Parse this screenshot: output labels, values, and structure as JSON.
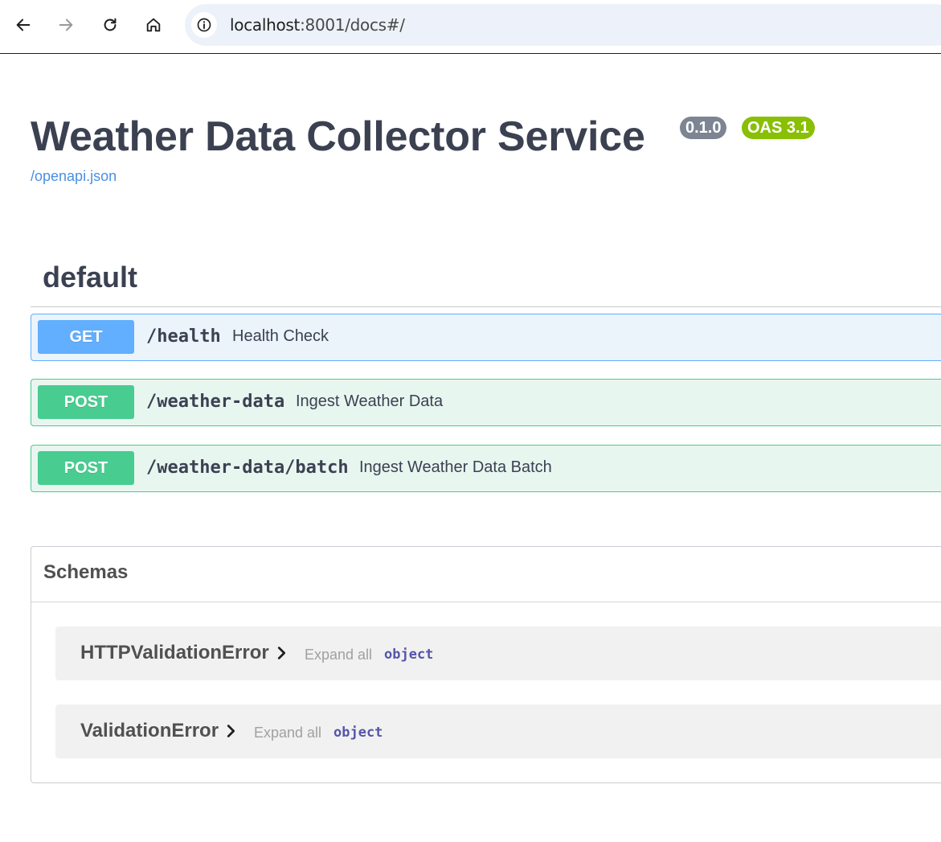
{
  "browser": {
    "url_host": "localhost",
    "url_rest": ":8001/docs#/",
    "icons": [
      "back-arrow-icon",
      "forward-arrow-icon",
      "reload-icon",
      "home-icon",
      "info-icon"
    ]
  },
  "page": {
    "title": "Weather Data Collector Service",
    "version_badge": "0.1.0",
    "oas_badge": "OAS 3.1",
    "spec_link": "/openapi.json",
    "colors": {
      "get": "#61affe",
      "post": "#49cc90",
      "version": "#7d8492",
      "oas": "#89bf04",
      "link": "#4990e2"
    }
  },
  "tag": {
    "name": "default"
  },
  "operations": [
    {
      "method": "GET",
      "path": "/health",
      "summary": "Health Check"
    },
    {
      "method": "POST",
      "path": "/weather-data",
      "summary": "Ingest Weather Data"
    },
    {
      "method": "POST",
      "path": "/weather-data/batch",
      "summary": "Ingest Weather Data Batch"
    }
  ],
  "schemas": {
    "title": "Schemas",
    "items": [
      {
        "name": "HTTPValidationError",
        "expand_label": "Expand all",
        "type": "object"
      },
      {
        "name": "ValidationError",
        "expand_label": "Expand all",
        "type": "object"
      }
    ]
  }
}
